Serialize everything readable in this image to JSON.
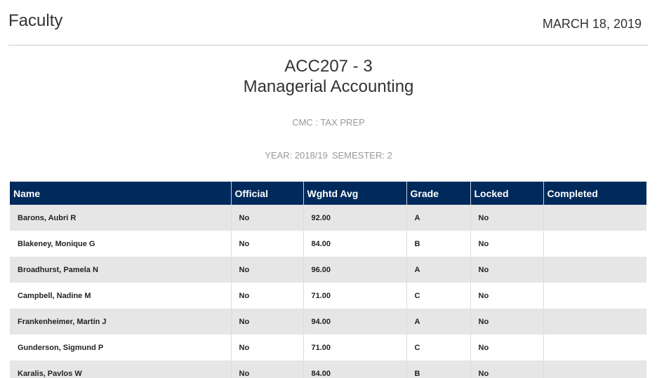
{
  "header": {
    "title": "Faculty",
    "date": "MARCH 18, 2019"
  },
  "course": {
    "code": "ACC207 - 3",
    "name": "Managerial Accounting",
    "program": "CMC : TAX PREP",
    "year": "YEAR: 2018/19",
    "semester": "SEMESTER: 2"
  },
  "table": {
    "columns": [
      "Name",
      "Official",
      "Wghtd Avg",
      "Grade",
      "Locked",
      "Completed"
    ],
    "rows": [
      {
        "name": "Barons, Aubri R",
        "official": "No",
        "avg": "92.00",
        "grade": "A",
        "locked": "No",
        "completed": ""
      },
      {
        "name": "Blakeney, Monique G",
        "official": "No",
        "avg": "84.00",
        "grade": "B",
        "locked": "No",
        "completed": ""
      },
      {
        "name": "Broadhurst, Pamela N",
        "official": "No",
        "avg": "96.00",
        "grade": "A",
        "locked": "No",
        "completed": ""
      },
      {
        "name": "Campbell, Nadine M",
        "official": "No",
        "avg": "71.00",
        "grade": "C",
        "locked": "No",
        "completed": ""
      },
      {
        "name": "Frankenheimer, Martin J",
        "official": "No",
        "avg": "94.00",
        "grade": "A",
        "locked": "No",
        "completed": ""
      },
      {
        "name": "Gunderson, Sigmund P",
        "official": "No",
        "avg": "71.00",
        "grade": "C",
        "locked": "No",
        "completed": ""
      },
      {
        "name": "Karalis, Pavlos W",
        "official": "No",
        "avg": "84.00",
        "grade": "B",
        "locked": "No",
        "completed": ""
      }
    ]
  }
}
